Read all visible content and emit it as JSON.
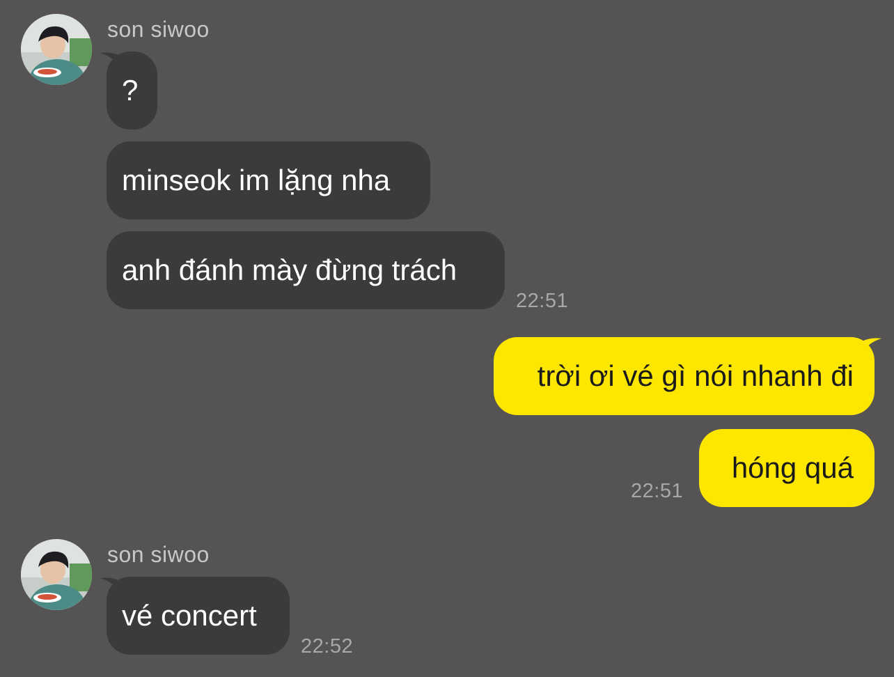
{
  "messages": [
    {
      "type": "incoming_group",
      "sender": "son siwoo",
      "bubbles": [
        "?",
        "minseok im lặng nha",
        "anh đánh mày đừng trách"
      ],
      "time": "22:51"
    },
    {
      "type": "outgoing_group",
      "bubbles": [
        "trời ơi vé gì nói nhanh đi",
        "hóng quá"
      ],
      "time": "22:51"
    },
    {
      "type": "incoming_group",
      "sender": "son siwoo",
      "bubbles": [
        "vé concert"
      ],
      "time": "22:52"
    }
  ],
  "colors": {
    "background": "#555354",
    "incoming_bubble": "#3b3a3c",
    "outgoing_bubble": "#fde600",
    "timestamp": "#a9a7a8",
    "sender_name": "#c9c7c8"
  },
  "icons": {
    "avatar": "profile-photo"
  }
}
